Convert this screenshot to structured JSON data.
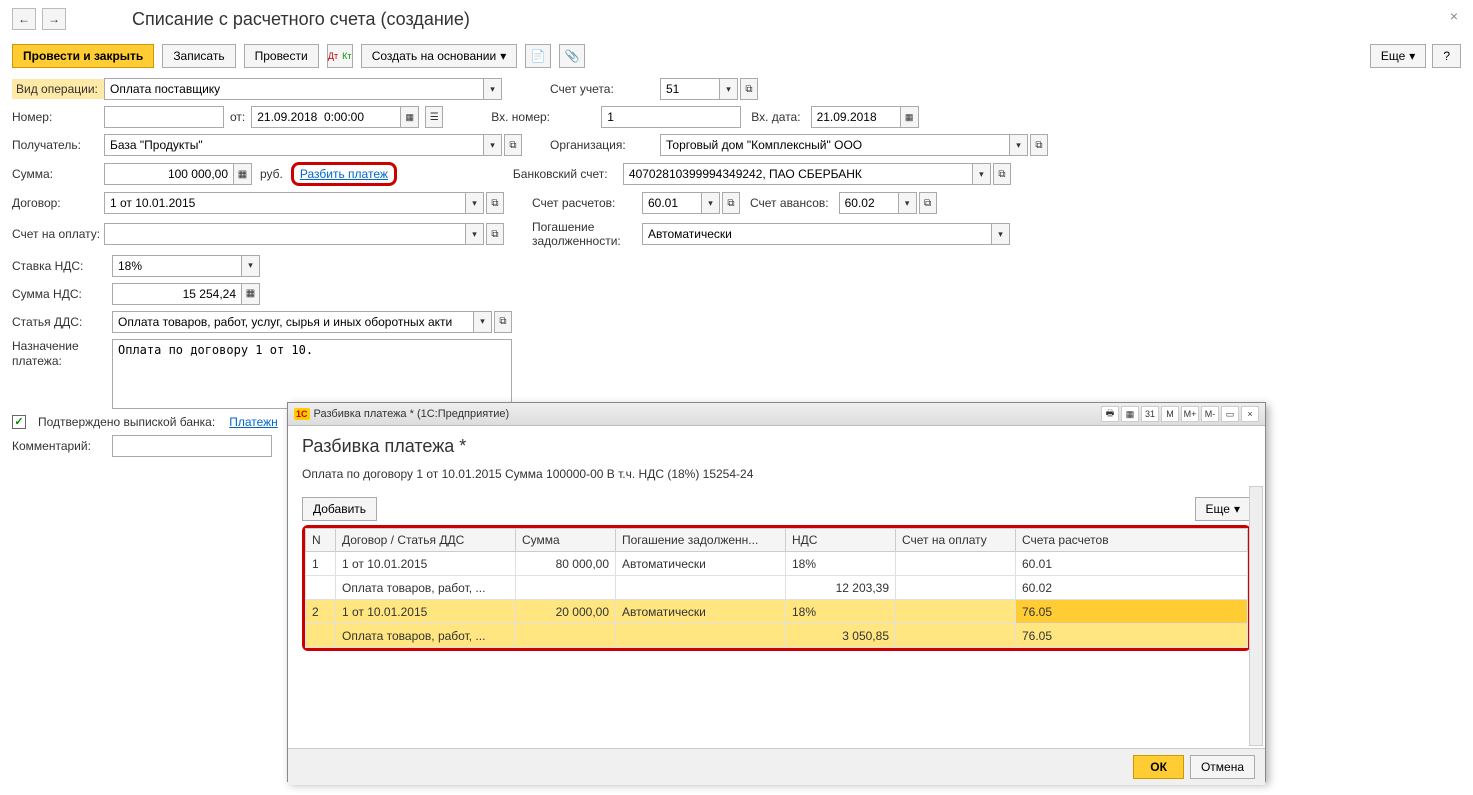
{
  "header": {
    "title": "Списание с расчетного счета (создание)"
  },
  "toolbar": {
    "post_close": "Провести и закрыть",
    "write": "Записать",
    "post": "Провести",
    "create_based": "Создать на основании",
    "more": "Еще",
    "help": "?"
  },
  "form": {
    "operation_type_label": "Вид операции:",
    "operation_type": "Оплата поставщику",
    "account_label": "Счет учета:",
    "account": "51",
    "number_label": "Номер:",
    "number": "",
    "date_label": "от:",
    "date": "21.09.2018  0:00:00",
    "in_number_label": "Вх. номер:",
    "in_number": "1",
    "in_date_label": "Вх. дата:",
    "in_date": "21.09.2018",
    "recipient_label": "Получатель:",
    "recipient": "База \"Продукты\"",
    "org_label": "Организация:",
    "org": "Торговый дом \"Комплексный\" ООО",
    "sum_label": "Сумма:",
    "sum": "100 000,00",
    "currency": "руб.",
    "split_link": "Разбить платеж",
    "bank_acc_label": "Банковский счет:",
    "bank_acc": "40702810399994349242, ПАО СБЕРБАНК",
    "contract_label": "Договор:",
    "contract": "1 от 10.01.2015",
    "settle_acc_label": "Счет расчетов:",
    "settle_acc": "60.01",
    "advance_acc_label": "Счет авансов:",
    "advance_acc": "60.02",
    "invoice_label": "Счет на оплату:",
    "invoice": "",
    "debt_label": "Погашение задолженности:",
    "debt": "Автоматически",
    "vat_rate_label": "Ставка НДС:",
    "vat_rate": "18%",
    "vat_sum_label": "Сумма НДС:",
    "vat_sum": "15 254,24",
    "dds_label": "Статья ДДС:",
    "dds": "Оплата товаров, работ, услуг, сырья и иных оборотных акти",
    "purpose_label": "Назначение платежа:",
    "purpose": "Оплата по договору 1 от 10.",
    "confirmed_label": "Подтверждено выпиской банка:",
    "payment_order_link": "Платежн",
    "comment_label": "Комментарий:",
    "comment": ""
  },
  "modal": {
    "titlebar": "Разбивка платежа *  (1С:Предприятие)",
    "title": "Разбивка платежа *",
    "subtitle": "Оплата по договору 1 от 10.01.2015 Сумма 100000-00 В т.ч. НДС  (18%)  15254-24",
    "add_btn": "Добавить",
    "more_btn": "Еще",
    "tb_icons": [
      "M",
      "M+",
      "M-"
    ],
    "columns": [
      "N",
      "Договор / Статья ДДС",
      "Сумма",
      "Погашение задолженн...",
      "НДС",
      "Счет на оплату",
      "Счета расчетов"
    ],
    "rows": [
      {
        "n": "1",
        "contract": "1 от 10.01.2015",
        "sum": "80 000,00",
        "debt": "Автоматически",
        "vat": "18%",
        "invoice": "",
        "acc": "60.01"
      },
      {
        "n": "",
        "contract": "Оплата товаров, работ, ...",
        "sum": "",
        "debt": "",
        "vat": "12 203,39",
        "invoice": "",
        "acc": "60.02"
      },
      {
        "n": "2",
        "contract": "1 от 10.01.2015",
        "sum": "20 000,00",
        "debt": "Автоматически",
        "vat": "18%",
        "invoice": "",
        "acc": "76.05",
        "selected": true,
        "highlight_acc": true
      },
      {
        "n": "",
        "contract": "Оплата товаров, работ, ...",
        "sum": "",
        "debt": "",
        "vat": "3 050,85",
        "invoice": "",
        "acc": "76.05",
        "selected": true
      }
    ],
    "ok": "ОК",
    "cancel": "Отмена"
  }
}
